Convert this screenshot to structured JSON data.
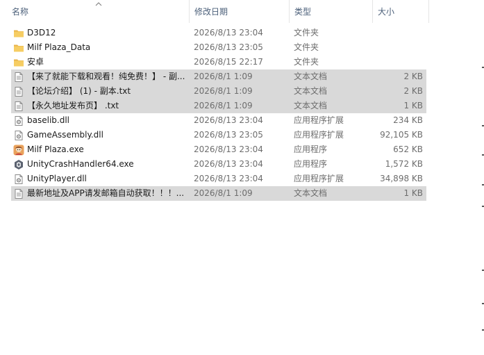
{
  "columns": {
    "name": "名称",
    "date": "修改日期",
    "type": "类型",
    "size": "大小"
  },
  "rows": [
    {
      "name": "D3D12",
      "date": "2026/8/13 23:04",
      "type": "文件夹",
      "size": "",
      "icon": "folder-icon",
      "selected": false
    },
    {
      "name": "Milf Plaza_Data",
      "date": "2026/8/13 23:05",
      "type": "文件夹",
      "size": "",
      "icon": "folder-icon",
      "selected": false
    },
    {
      "name": "安卓",
      "date": "2026/8/15 22:17",
      "type": "文件夹",
      "size": "",
      "icon": "folder-icon",
      "selected": false
    },
    {
      "name": "【来了就能下载和观看！纯免费！】 - 副...",
      "date": "2026/8/1 1:09",
      "type": "文本文档",
      "size": "2 KB",
      "icon": "text-file-icon",
      "selected": true
    },
    {
      "name": "【论坛介绍】 (1) - 副本.txt",
      "date": "2026/8/1 1:09",
      "type": "文本文档",
      "size": "2 KB",
      "icon": "text-file-icon",
      "selected": true
    },
    {
      "name": "【永久地址发布页】 .txt",
      "date": "2026/8/1 1:09",
      "type": "文本文档",
      "size": "1 KB",
      "icon": "text-file-icon",
      "selected": true
    },
    {
      "name": "baselib.dll",
      "date": "2026/8/13 23:04",
      "type": "应用程序扩展",
      "size": "234 KB",
      "icon": "dll-file-icon",
      "selected": false
    },
    {
      "name": "GameAssembly.dll",
      "date": "2026/8/13 23:05",
      "type": "应用程序扩展",
      "size": "92,105 KB",
      "icon": "dll-file-icon",
      "selected": false
    },
    {
      "name": "Milf Plaza.exe",
      "date": "2026/8/13 23:04",
      "type": "应用程序",
      "size": "652 KB",
      "icon": "game-exe-icon",
      "selected": false
    },
    {
      "name": "UnityCrashHandler64.exe",
      "date": "2026/8/13 23:04",
      "type": "应用程序",
      "size": "1,572 KB",
      "icon": "unity-exe-icon",
      "selected": false
    },
    {
      "name": "UnityPlayer.dll",
      "date": "2026/8/13 23:04",
      "type": "应用程序扩展",
      "size": "34,898 KB",
      "icon": "dll-file-icon",
      "selected": false
    },
    {
      "name": "最新地址及APP请发邮箱自动获取！！！...",
      "date": "2026/8/1 1:09",
      "type": "文本文档",
      "size": "1 KB",
      "icon": "text-file-icon",
      "selected": true
    }
  ],
  "colors": {
    "header_text": "#4c607a",
    "selection": "#d9d9d9",
    "folder": "#f2c55c",
    "meta_text": "#6d6d6d"
  }
}
